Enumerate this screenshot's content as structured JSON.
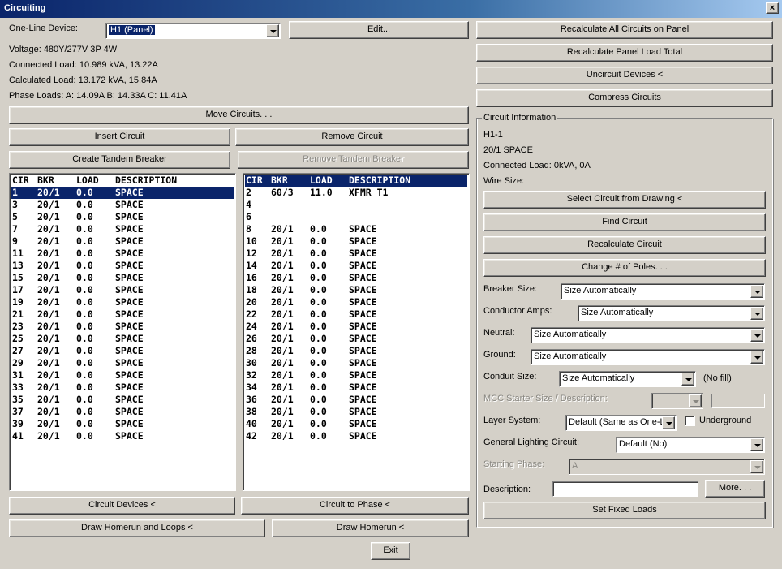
{
  "window": {
    "title": "Circuiting",
    "close_glyph": "×"
  },
  "device": {
    "label": "One-Line Device:",
    "selected": "H1 (Panel)",
    "edit_label": "Edit..."
  },
  "info": {
    "voltage": "Voltage: 480Y/277V 3P 4W",
    "connected_load": "Connected Load: 10.989 kVA, 13.22A",
    "calculated_load": "Calculated Load: 13.172 kVA, 15.84A",
    "phase_loads": "Phase Loads: A: 14.09A   B: 14.33A   C: 11.41A"
  },
  "buttons": {
    "move_circuits": "Move Circuits. . .",
    "insert_circuit": "Insert Circuit",
    "remove_circuit": "Remove Circuit",
    "create_tandem": "Create Tandem Breaker",
    "remove_tandem": "Remove Tandem Breaker",
    "circuit_devices": "Circuit Devices <",
    "circuit_to_phase": "Circuit to Phase <",
    "draw_homerun_loops": "Draw Homerun and Loops <",
    "draw_homerun": "Draw Homerun <",
    "exit": "Exit",
    "recalc_all": "Recalculate All Circuits on Panel",
    "recalc_panel_total": "Recalculate Panel Load Total",
    "uncircuit_devices": "Uncircuit Devices <",
    "compress_circuits": "Compress Circuits"
  },
  "list_headers": {
    "cir": "CIR",
    "bkr": "BKR",
    "load": "LOAD",
    "desc": "DESCRIPTION"
  },
  "left_circuits": [
    {
      "cir": "1",
      "bkr": "20/1",
      "load": "0.0",
      "desc": "SPACE"
    },
    {
      "cir": "3",
      "bkr": "20/1",
      "load": "0.0",
      "desc": "SPACE"
    },
    {
      "cir": "5",
      "bkr": "20/1",
      "load": "0.0",
      "desc": "SPACE"
    },
    {
      "cir": "7",
      "bkr": "20/1",
      "load": "0.0",
      "desc": "SPACE"
    },
    {
      "cir": "9",
      "bkr": "20/1",
      "load": "0.0",
      "desc": "SPACE"
    },
    {
      "cir": "11",
      "bkr": "20/1",
      "load": "0.0",
      "desc": "SPACE"
    },
    {
      "cir": "13",
      "bkr": "20/1",
      "load": "0.0",
      "desc": "SPACE"
    },
    {
      "cir": "15",
      "bkr": "20/1",
      "load": "0.0",
      "desc": "SPACE"
    },
    {
      "cir": "17",
      "bkr": "20/1",
      "load": "0.0",
      "desc": "SPACE"
    },
    {
      "cir": "19",
      "bkr": "20/1",
      "load": "0.0",
      "desc": "SPACE"
    },
    {
      "cir": "21",
      "bkr": "20/1",
      "load": "0.0",
      "desc": "SPACE"
    },
    {
      "cir": "23",
      "bkr": "20/1",
      "load": "0.0",
      "desc": "SPACE"
    },
    {
      "cir": "25",
      "bkr": "20/1",
      "load": "0.0",
      "desc": "SPACE"
    },
    {
      "cir": "27",
      "bkr": "20/1",
      "load": "0.0",
      "desc": "SPACE"
    },
    {
      "cir": "29",
      "bkr": "20/1",
      "load": "0.0",
      "desc": "SPACE"
    },
    {
      "cir": "31",
      "bkr": "20/1",
      "load": "0.0",
      "desc": "SPACE"
    },
    {
      "cir": "33",
      "bkr": "20/1",
      "load": "0.0",
      "desc": "SPACE"
    },
    {
      "cir": "35",
      "bkr": "20/1",
      "load": "0.0",
      "desc": "SPACE"
    },
    {
      "cir": "37",
      "bkr": "20/1",
      "load": "0.0",
      "desc": "SPACE"
    },
    {
      "cir": "39",
      "bkr": "20/1",
      "load": "0.0",
      "desc": "SPACE"
    },
    {
      "cir": "41",
      "bkr": "20/1",
      "load": "0.0",
      "desc": "SPACE"
    }
  ],
  "right_circuits": [
    {
      "cir": "2",
      "bkr": "60/3",
      "load": "11.0",
      "desc": "XFMR T1"
    },
    {
      "cir": "4",
      "bkr": "",
      "load": "",
      "desc": ""
    },
    {
      "cir": "6",
      "bkr": "",
      "load": "",
      "desc": ""
    },
    {
      "cir": "8",
      "bkr": "20/1",
      "load": "0.0",
      "desc": "SPACE"
    },
    {
      "cir": "10",
      "bkr": "20/1",
      "load": "0.0",
      "desc": "SPACE"
    },
    {
      "cir": "12",
      "bkr": "20/1",
      "load": "0.0",
      "desc": "SPACE"
    },
    {
      "cir": "14",
      "bkr": "20/1",
      "load": "0.0",
      "desc": "SPACE"
    },
    {
      "cir": "16",
      "bkr": "20/1",
      "load": "0.0",
      "desc": "SPACE"
    },
    {
      "cir": "18",
      "bkr": "20/1",
      "load": "0.0",
      "desc": "SPACE"
    },
    {
      "cir": "20",
      "bkr": "20/1",
      "load": "0.0",
      "desc": "SPACE"
    },
    {
      "cir": "22",
      "bkr": "20/1",
      "load": "0.0",
      "desc": "SPACE"
    },
    {
      "cir": "24",
      "bkr": "20/1",
      "load": "0.0",
      "desc": "SPACE"
    },
    {
      "cir": "26",
      "bkr": "20/1",
      "load": "0.0",
      "desc": "SPACE"
    },
    {
      "cir": "28",
      "bkr": "20/1",
      "load": "0.0",
      "desc": "SPACE"
    },
    {
      "cir": "30",
      "bkr": "20/1",
      "load": "0.0",
      "desc": "SPACE"
    },
    {
      "cir": "32",
      "bkr": "20/1",
      "load": "0.0",
      "desc": "SPACE"
    },
    {
      "cir": "34",
      "bkr": "20/1",
      "load": "0.0",
      "desc": "SPACE"
    },
    {
      "cir": "36",
      "bkr": "20/1",
      "load": "0.0",
      "desc": "SPACE"
    },
    {
      "cir": "38",
      "bkr": "20/1",
      "load": "0.0",
      "desc": "SPACE"
    },
    {
      "cir": "40",
      "bkr": "20/1",
      "load": "0.0",
      "desc": "SPACE"
    },
    {
      "cir": "42",
      "bkr": "20/1",
      "load": "0.0",
      "desc": "SPACE"
    }
  ],
  "circuit_info": {
    "group_title": "Circuit Information",
    "circuit_id": "H1-1",
    "breaker_desc": "20/1   SPACE",
    "connected_load": "Connected Load: 0kVA, 0A",
    "wire_size": "Wire Size:",
    "select_from_drawing": "Select Circuit from Drawing <",
    "find_circuit": "Find Circuit",
    "recalc_circuit": "Recalculate Circuit",
    "change_poles": "Change # of Poles. . .",
    "breaker_size_label": "Breaker Size:",
    "breaker_size_value": "Size Automatically",
    "conductor_amps_label": "Conductor Amps:",
    "conductor_amps_value": "Size Automatically",
    "neutral_label": "Neutral:",
    "neutral_value": "Size Automatically",
    "ground_label": "Ground:",
    "ground_value": "Size Automatically",
    "conduit_label": "Conduit Size:",
    "conduit_value": "Size Automatically",
    "no_fill": "(No fill)",
    "mcc_label": "MCC Starter Size / Description:",
    "mcc_value": "",
    "layer_label": "Layer System:",
    "layer_value": "Default (Same as One-Li",
    "underground_label": "Underground",
    "underground_checked": false,
    "glc_label": "General Lighting Circuit:",
    "glc_value": "Default (No)",
    "phase_label": "Starting Phase:",
    "phase_value": "A",
    "description_label": "Description:",
    "description_value": "",
    "more": "More. . .",
    "set_fixed_loads": "Set Fixed Loads"
  },
  "colors": {
    "face": "#d4d0c8",
    "selection": "#0a246a",
    "title_start": "#0a246a",
    "title_end": "#a6caf0",
    "disabled_text": "#8a8882"
  },
  "selected_left_index": 0
}
